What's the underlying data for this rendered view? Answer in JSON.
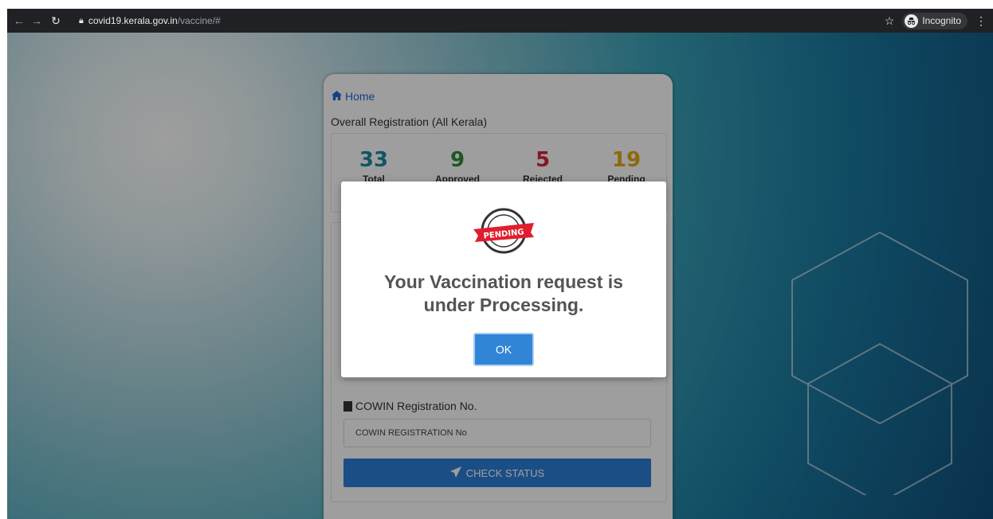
{
  "browser": {
    "url_host": "covid19.kerala.gov.in",
    "url_path": "/vaccine/#",
    "incognito_label": "Incognito",
    "icons": [
      "back-arrow-icon",
      "forward-arrow-icon",
      "reload-icon",
      "lock-icon",
      "star-icon",
      "incognito-icon",
      "kebab-menu-icon"
    ]
  },
  "card": {
    "home_label": "Home",
    "overall_title": "Overall Registration (All Kerala)",
    "stats": [
      {
        "value": "33",
        "label": "Total",
        "color": "#1f8a9e"
      },
      {
        "value": "9",
        "label": "Approved",
        "color": "#2e8b3a"
      },
      {
        "value": "5",
        "label": "Rejected",
        "color": "#d7263d"
      },
      {
        "value": "19",
        "label": "Pending",
        "color": "#e6a817"
      }
    ],
    "cowin_label": "COWIN Registration No.",
    "cowin_placeholder": "COWIN REGISTRATION No",
    "check_status_label": "CHECK STATUS"
  },
  "modal": {
    "badge_text": "PENDING",
    "message_line1": "Your Vaccination request is",
    "message_line2": "under Processing.",
    "ok_label": "OK"
  },
  "colors": {
    "primary_button": "#3085d6",
    "check_status_button": "#2e7fd9",
    "link": "#1e6bd6",
    "badge_red": "#e01e2d"
  }
}
